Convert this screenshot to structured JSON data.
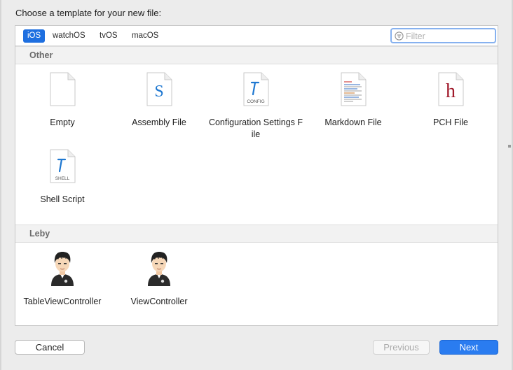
{
  "dialog": {
    "prompt": "Choose a template for your new file:"
  },
  "platform_tabs": [
    {
      "label": "iOS",
      "active": true
    },
    {
      "label": "watchOS",
      "active": false
    },
    {
      "label": "tvOS",
      "active": false
    },
    {
      "label": "macOS",
      "active": false
    }
  ],
  "filter": {
    "placeholder": "Filter",
    "value": ""
  },
  "sections": [
    {
      "title": "Other",
      "templates": [
        {
          "label": "Empty",
          "icon": "blank-document-icon"
        },
        {
          "label": "Assembly File",
          "icon": "assembly-file-icon",
          "glyph": "S"
        },
        {
          "label": "Configuration Settings File",
          "icon": "config-file-icon",
          "badge": "CONFIG"
        },
        {
          "label": "Markdown File",
          "icon": "markdown-file-icon"
        },
        {
          "label": "PCH File",
          "icon": "pch-file-icon",
          "glyph": "h"
        },
        {
          "label": "Shell Script",
          "icon": "shell-script-icon",
          "badge": "SHELL"
        }
      ]
    },
    {
      "title": "Leby",
      "templates": [
        {
          "label": "TableViewController",
          "icon": "avatar-icon"
        },
        {
          "label": "ViewController",
          "icon": "avatar-icon"
        }
      ]
    }
  ],
  "buttons": {
    "cancel": "Cancel",
    "previous": "Previous",
    "next": "Next"
  },
  "colors": {
    "accent": "#2a7cf0",
    "tab_active": "#1e6fe0",
    "assembly_glyph": "#1f78d1",
    "pch_glyph": "#a0192a"
  }
}
